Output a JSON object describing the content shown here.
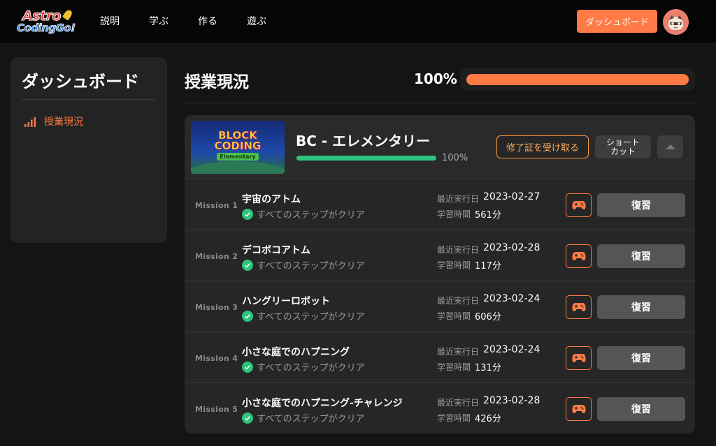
{
  "nav": {
    "logo_line1": "Astro",
    "logo_line2": "CodingGo!",
    "items": [
      {
        "label": "説明"
      },
      {
        "label": "学ぶ"
      },
      {
        "label": "作る"
      },
      {
        "label": "遊ぶ"
      }
    ],
    "dashboard_button": "ダッシュボード"
  },
  "sidebar": {
    "title": "ダッシュボード",
    "items": [
      {
        "label": "授業現況",
        "icon": "signal-bars-icon",
        "active": true
      }
    ]
  },
  "main": {
    "title": "授業現況",
    "progress_label": "100%",
    "progress_value": 1.0,
    "accent_color": "#ff7a45"
  },
  "course": {
    "thumbnail_line1": "BLOCK",
    "thumbnail_line2": "CODING",
    "thumbnail_line3": "Elementary",
    "title": "BC - エレメンタリー",
    "progress_label": "100%",
    "progress_value": 1.0,
    "progress_color": "#2ec27e",
    "certificate_button": "修了証を受け取る",
    "shortcut_button": "ショートカット",
    "collapse_icon": "chevron-up-icon"
  },
  "missions": [
    {
      "label": "Mission 1",
      "title": "宇宙のアトム",
      "status": "すべてのステップがクリア",
      "date_label": "最近実行日",
      "date": "2023-02-27",
      "time_label": "学習時間",
      "time": "561分",
      "review": "復習"
    },
    {
      "label": "Mission 2",
      "title": "デコボコアトム",
      "status": "すべてのステップがクリア",
      "date_label": "最近実行日",
      "date": "2023-02-28",
      "time_label": "学習時間",
      "time": "117分",
      "review": "復習"
    },
    {
      "label": "Mission 3",
      "title": "ハングリーロボット",
      "status": "すべてのステップがクリア",
      "date_label": "最近実行日",
      "date": "2023-02-24",
      "time_label": "学習時間",
      "time": "606分",
      "review": "復習"
    },
    {
      "label": "Mission 4",
      "title": "小さな庭でのハプニング",
      "status": "すべてのステップがクリア",
      "date_label": "最近実行日",
      "date": "2023-02-24",
      "time_label": "学習時間",
      "time": "131分",
      "review": "復習"
    },
    {
      "label": "Mission 5",
      "title": "小さな庭でのハプニング-チャレンジ",
      "status": "すべてのステップがクリア",
      "date_label": "最近実行日",
      "date": "2023-02-28",
      "time_label": "学習時間",
      "time": "426分",
      "review": "復習"
    }
  ]
}
